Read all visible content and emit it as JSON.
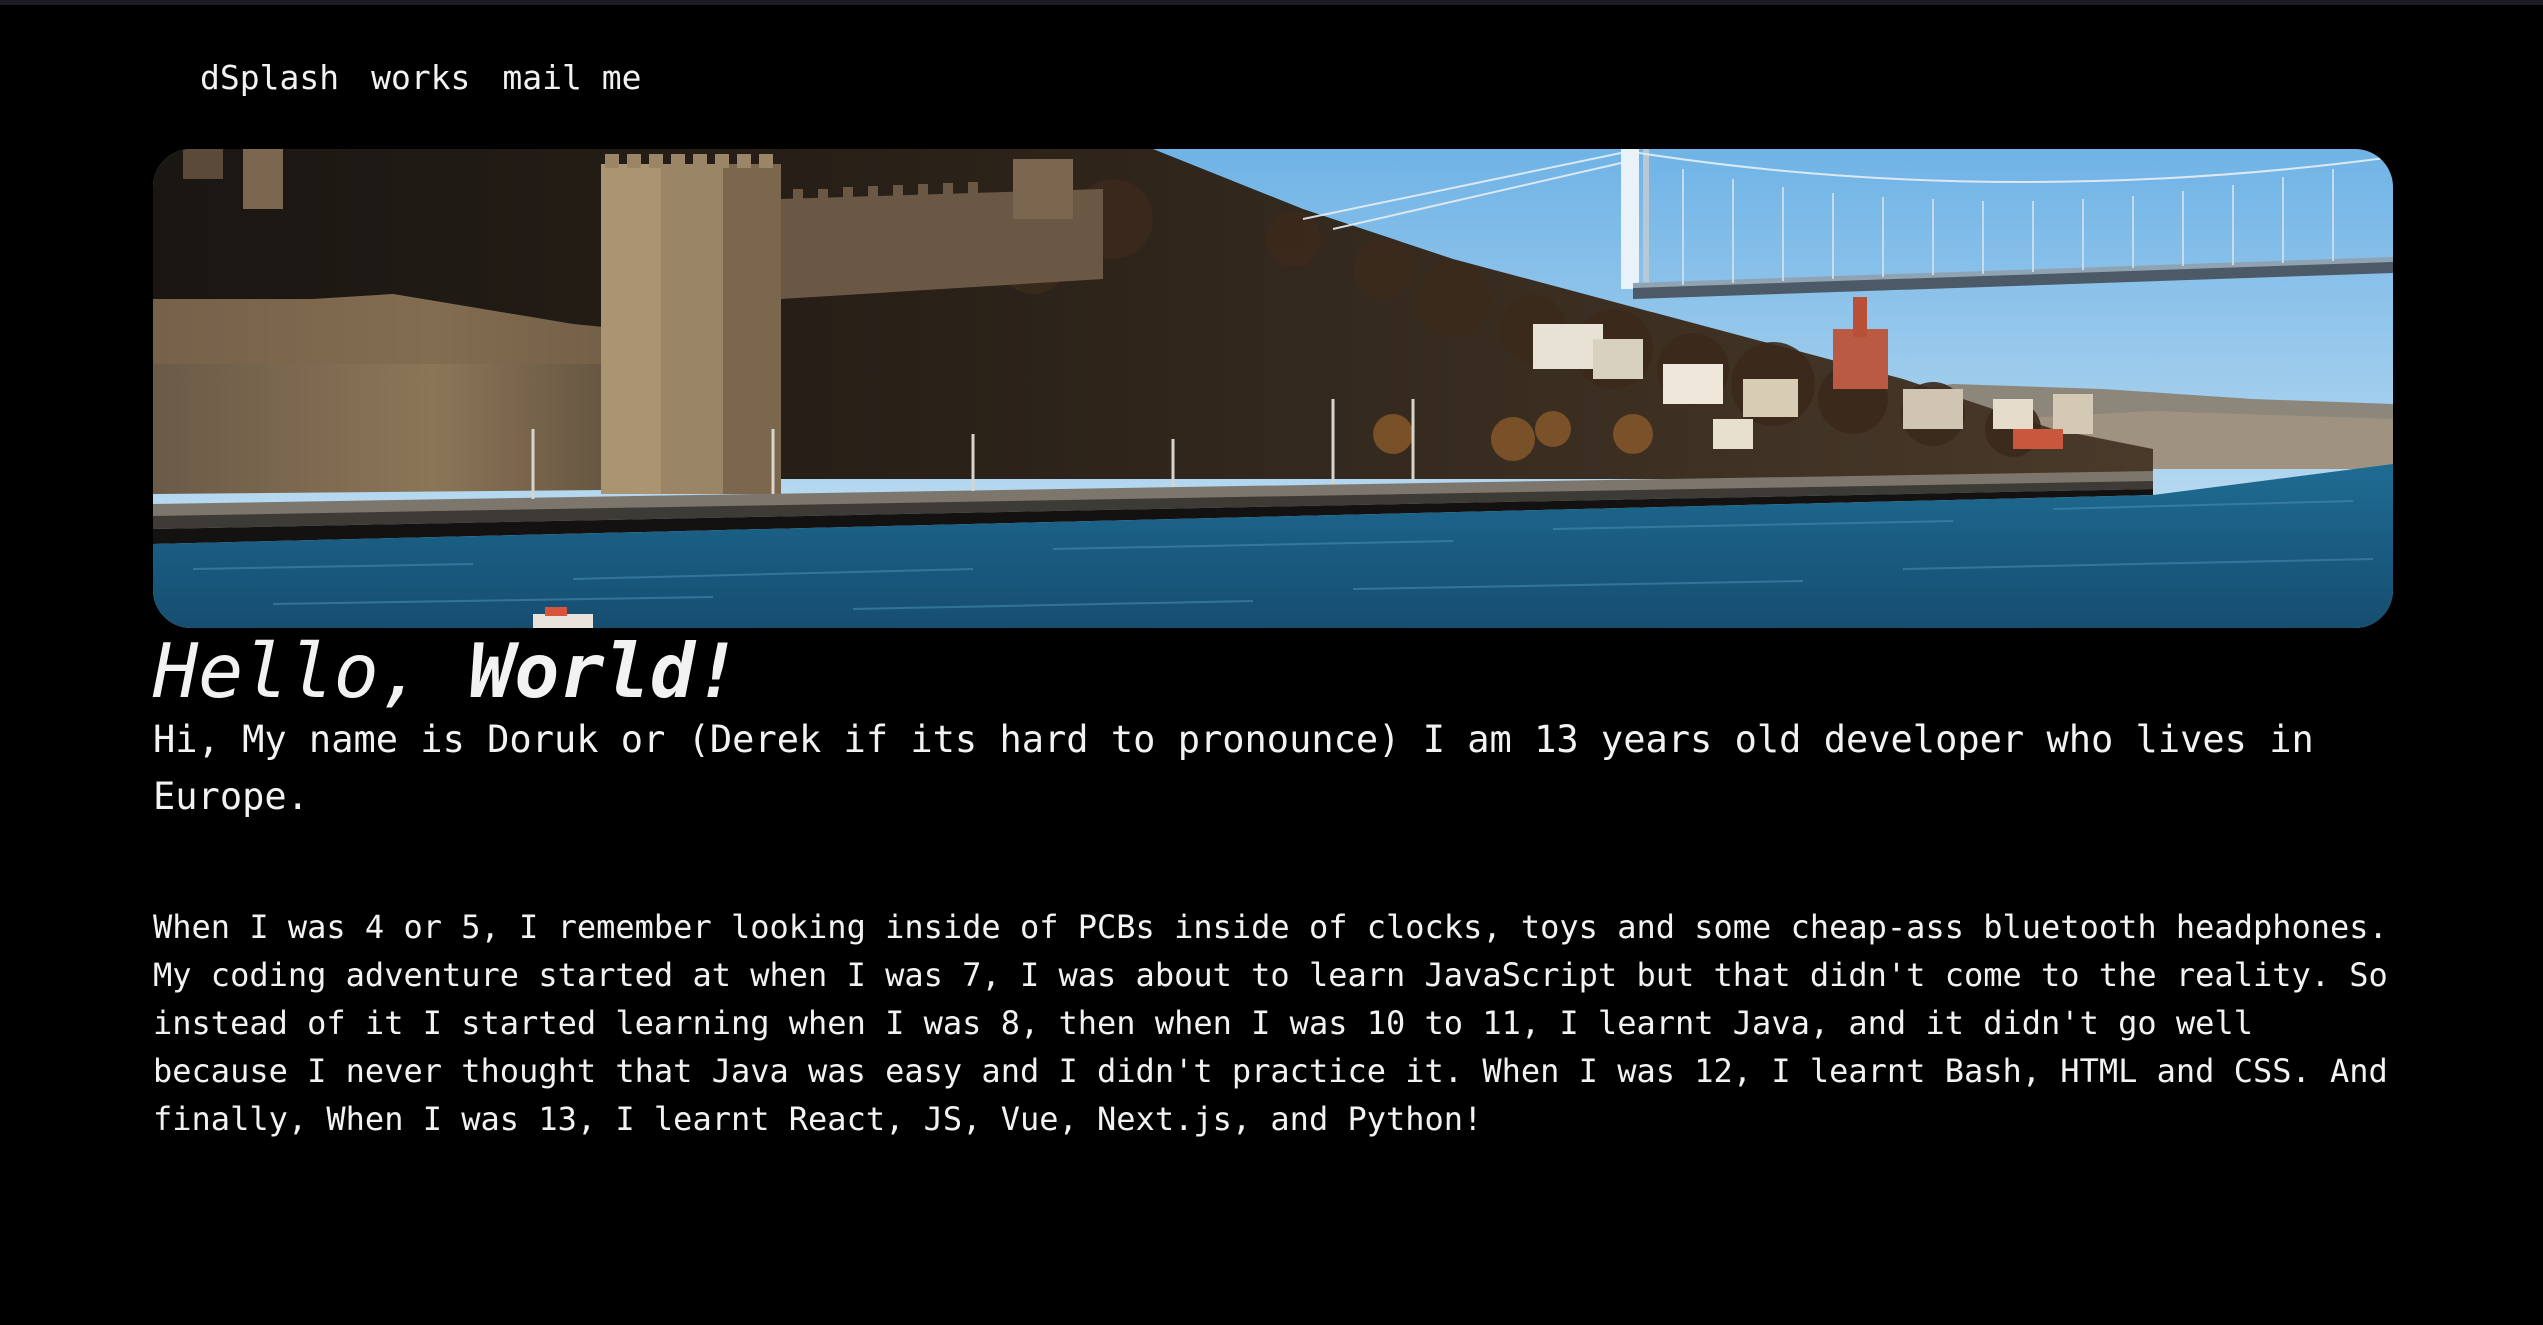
{
  "nav": {
    "items": [
      {
        "label": "dSplash"
      },
      {
        "label": "works"
      },
      {
        "label": "mail me"
      }
    ]
  },
  "hero": {
    "icon": "photo-istanbul-bosphorus"
  },
  "heading": {
    "regular": "Hello, ",
    "bold": "World!"
  },
  "intro": "Hi, My name is Doruk or (Derek if its hard to pronounce) I am 13 years old developer who lives in Europe.",
  "story": "When I was 4 or 5, I remember looking inside of PCBs inside of clocks, toys and some cheap-ass bluetooth headphones. My coding adventure started at when I was 7, I was about to learn JavaScript but that didn't come to the reality. So instead of it I started learning when I was 8, then when I was 10 to 11, I learnt Java, and it didn't go well because I never thought that Java was easy and I didn't practice it. When I was 12, I learnt Bash, HTML and CSS. And finally, When I was 13, I learnt React, JS, Vue, Next.js, and Python!",
  "colors": {
    "background": "#000000",
    "text": "#f2f2f2"
  }
}
